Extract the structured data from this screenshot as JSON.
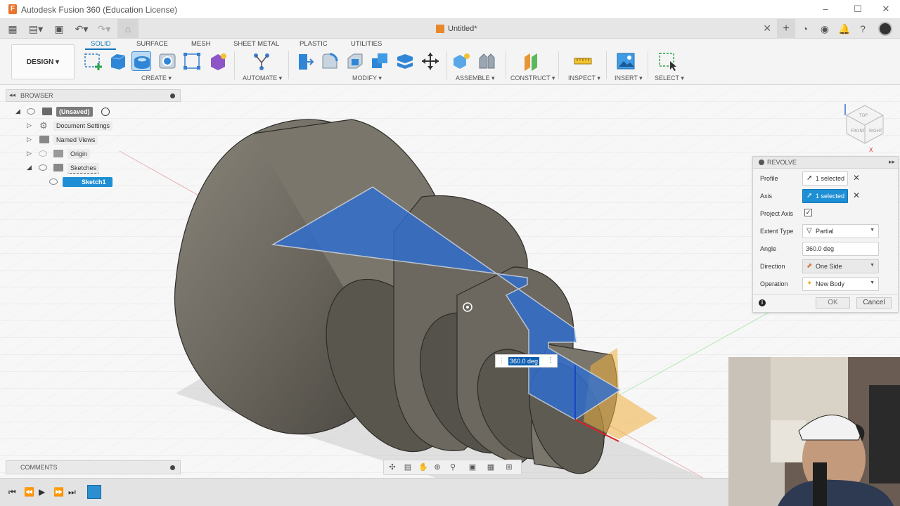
{
  "window": {
    "title": "Autodesk Fusion 360 (Education License)"
  },
  "app_toolbar": {
    "tab_title": "Untitled*"
  },
  "ribbon": {
    "workspace": "DESIGN ▾",
    "tabs": [
      "SOLID",
      "SURFACE",
      "MESH",
      "SHEET METAL",
      "PLASTIC",
      "UTILITIES"
    ],
    "active_tab": "SOLID",
    "groups": [
      "CREATE ▾",
      "AUTOMATE ▾",
      "MODIFY ▾",
      "ASSEMBLE ▾",
      "CONSTRUCT ▾",
      "INSPECT ▾",
      "INSERT ▾",
      "SELECT ▾"
    ]
  },
  "browser": {
    "header": "BROWSER",
    "items": [
      {
        "label": "(Unsaved)"
      },
      {
        "label": "Document Settings"
      },
      {
        "label": "Named Views"
      },
      {
        "label": "Origin"
      },
      {
        "label": "Sketches"
      },
      {
        "label": "Sketch1"
      }
    ]
  },
  "revolve": {
    "title": "REVOLVE",
    "profile_label": "Profile",
    "profile_value": "1 selected",
    "axis_label": "Axis",
    "axis_value": "1 selected",
    "project_axis_label": "Project Axis",
    "project_axis_checked": true,
    "extent_type_label": "Extent Type",
    "extent_type_value": "Partial",
    "angle_label": "Angle",
    "angle_value": "360.0 deg",
    "direction_label": "Direction",
    "direction_value": "One Side",
    "operation_label": "Operation",
    "operation_value": "New Body",
    "ok_label": "OK",
    "cancel_label": "Cancel"
  },
  "dimension_input": {
    "value": "360.0 deg"
  },
  "comments": {
    "header": "COMMENTS"
  },
  "colors": {
    "accent": "#0f74b8",
    "profile_blue": "#2f6fd0",
    "body_gray": "#6e6a60",
    "axis_orange": "#f0b040"
  }
}
